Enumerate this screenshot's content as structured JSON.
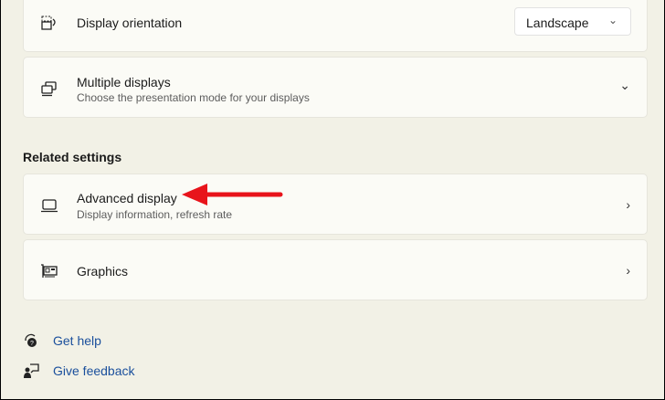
{
  "cards": [
    {
      "title": "Display orientation",
      "icon": "rotate-display-icon",
      "dropdown": {
        "selected": "Landscape"
      }
    },
    {
      "title": "Multiple displays",
      "subtitle": "Choose the presentation mode for your displays",
      "icon": "multiple-displays-icon"
    }
  ],
  "related": {
    "heading": "Related settings",
    "items": [
      {
        "title": "Advanced display",
        "subtitle": "Display information, refresh rate",
        "icon": "laptop-icon"
      },
      {
        "title": "Graphics",
        "icon": "graphics-card-icon"
      }
    ]
  },
  "links": {
    "help": "Get help",
    "feedback": "Give feedback"
  },
  "annotation": {
    "arrow_color": "#e8141b"
  }
}
